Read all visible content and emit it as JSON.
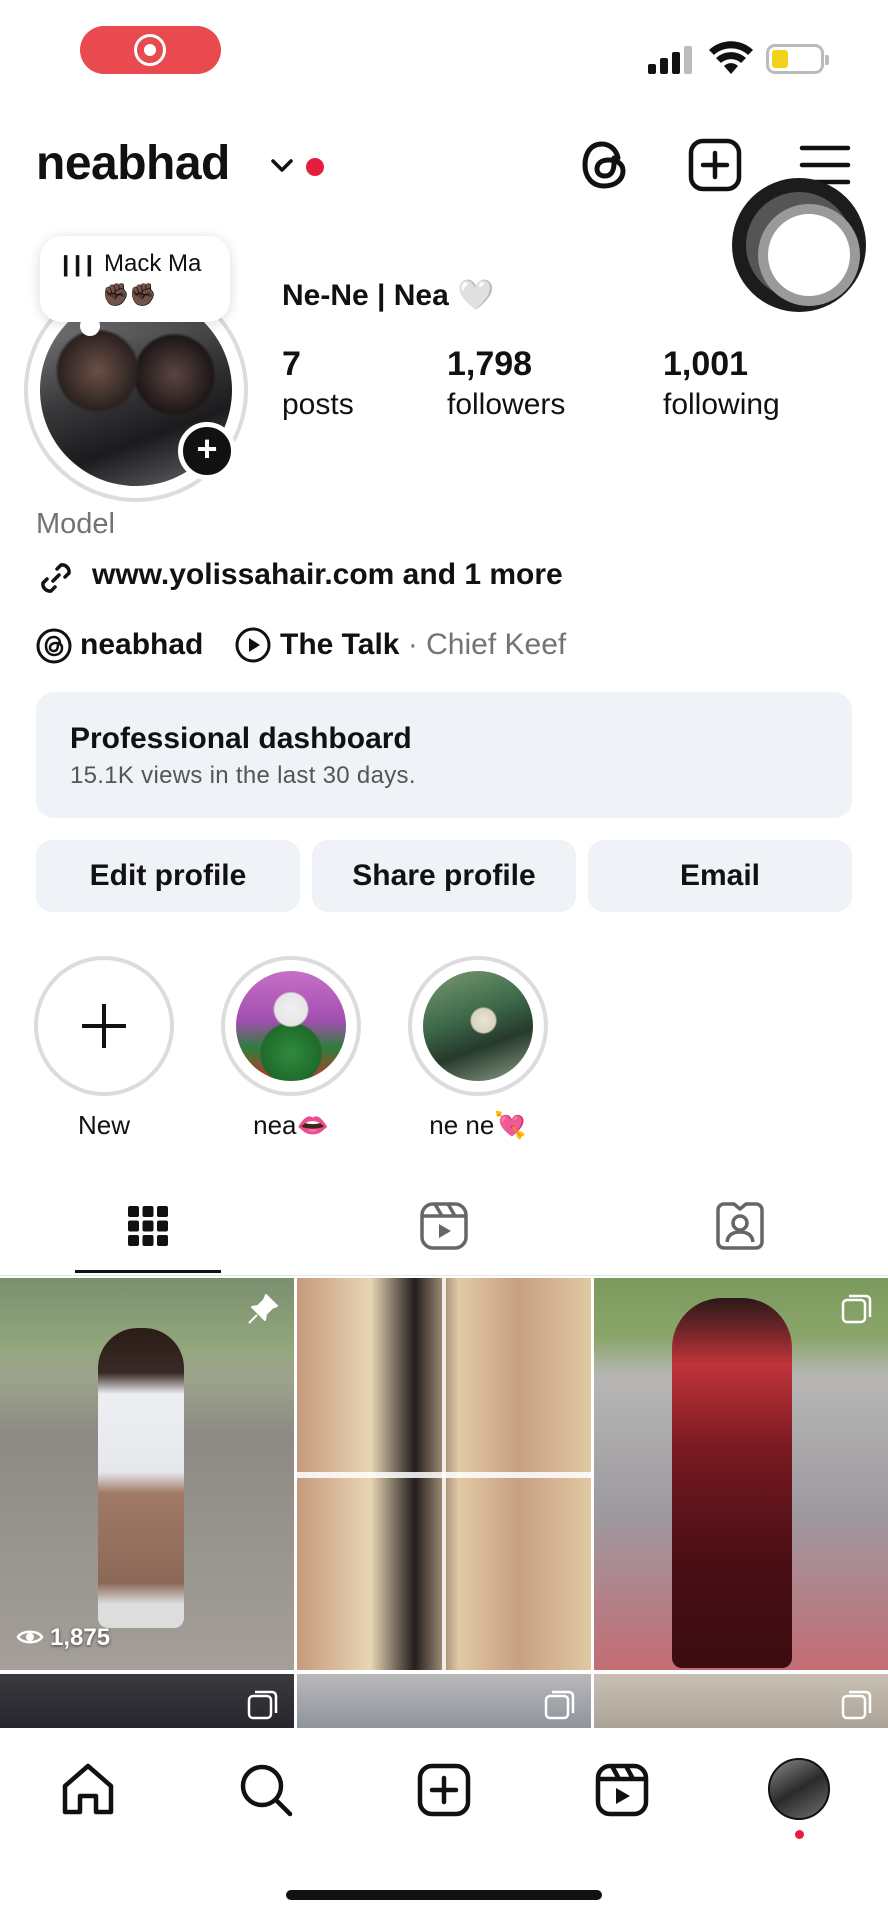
{
  "header": {
    "username": "neabhad"
  },
  "profile": {
    "note_title": "Mack Ma",
    "note_emoji": "✊🏿✊🏿",
    "display_name": "Ne-Ne | Nea 🤍",
    "stats": [
      {
        "value": "7",
        "label": "posts"
      },
      {
        "value": "1,798",
        "label": "followers"
      },
      {
        "value": "1,001",
        "label": "following"
      }
    ],
    "category": "Model",
    "link_text": "www.yolissahair.com and 1 more",
    "threads_handle": "neabhad",
    "song_title": "The Talk",
    "song_artist": " · Chief Keef"
  },
  "dashboard": {
    "title": "Professional dashboard",
    "subtitle": "15.1K views in the last 30 days."
  },
  "buttons": {
    "edit": "Edit profile",
    "share": "Share profile",
    "email": "Email"
  },
  "highlights": [
    {
      "label": "New"
    },
    {
      "label": "nea👄"
    },
    {
      "label": "ne ne💘"
    }
  ],
  "grid": {
    "first_post_views": "1,875"
  },
  "colors": {
    "accent_red": "#e41e3f",
    "button_bg": "#eff2f6",
    "recording_pill": "#e84a4f",
    "battery_yellow": "#f3d21c"
  }
}
